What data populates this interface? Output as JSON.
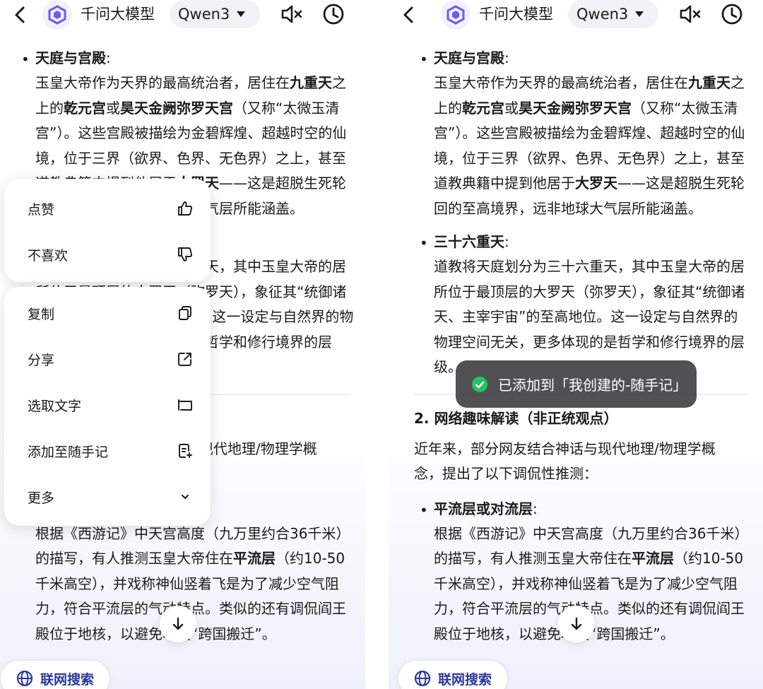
{
  "header": {
    "app_title": "千问大模型",
    "model": "Qwen3"
  },
  "article": {
    "s1_title": "天庭与宫殿",
    "s1_colon": ":",
    "s1_p": [
      {
        "t": "玉皇大帝作为天界的最高统治者，居住在"
      },
      {
        "t": "九重天",
        "b": true
      },
      {
        "t": "之上的"
      },
      {
        "t": "乾元宫",
        "b": true
      },
      {
        "t": "或"
      },
      {
        "t": "昊天金阙弥罗天宫",
        "b": true
      },
      {
        "t": "（又称“太微玉清宫”）。这些宫殿被描绘为金碧辉煌、超越时空的仙境，位于三界（欲界、色界、无色界）之上，甚至道教典籍中提到他居于"
      },
      {
        "t": "大罗天",
        "b": true
      },
      {
        "t": "——这是超脱生死轮回的至高境界，远非地球大气层所能涵盖。"
      }
    ],
    "s2_title": "三十六重天",
    "s2_colon": ":",
    "s2_p": [
      {
        "t": "道教将天庭划分为三十六重天，其中玉皇大帝的居所位于最顶层的大罗天（弥罗天），象征其“统御诸天、主宰宇宙”的至高地位。这一设定与自然界的物理空间无关，更多体现的是哲学和修行境界的层级。"
      }
    ],
    "h3": "2. 网络趣味解读（非正统观点）",
    "intro": "近年来，部分网友结合神话与现代地理/物理学概念，提出了以下调侃性推测：",
    "s3_title": "平流层或对流层",
    "s3_colon": ":",
    "s3_p": [
      {
        "t": "根据《西游记》中天宫高度（九万里约合36千米）的描写，有人推测玉皇大帝住在"
      },
      {
        "t": "平流层",
        "b": true
      },
      {
        "t": "（约10-50千米高空），并戏称神仙竖着飞是为了减少空气阻力，符合平流层的气动特点。类似的还有调侃阎王殿位于地核，以避免地幔“跨国搬迁”。"
      }
    ]
  },
  "context_menu": {
    "like": "点赞",
    "dislike": "不喜欢",
    "copy": "复制",
    "share": "分享",
    "select_text": "选取文字",
    "add_note": "添加至随手记",
    "more": "更多"
  },
  "web_search": "联网搜索",
  "toast": "已添加到「我创建的-随手记」",
  "colors": {
    "accent": "#6a5cf0",
    "web_search_text": "#2a3a9e",
    "toast_check": "#22c55e",
    "toast_bg": "#343438"
  }
}
